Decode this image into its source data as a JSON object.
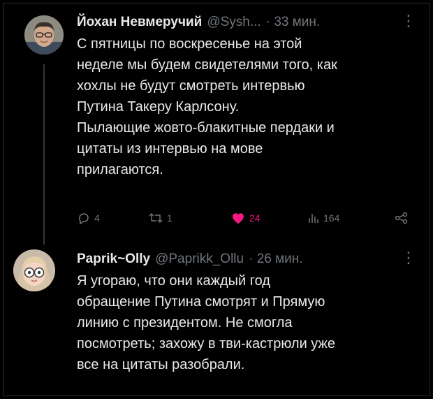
{
  "colors": {
    "background": "#000000",
    "text": "#e7e9ea",
    "muted": "#71767b",
    "like": "#f91880"
  },
  "tweets": [
    {
      "author": "Йохан Невмеручий",
      "handle": "@Sysh...",
      "time": "· 33 мин.",
      "more_icon": "more-dots-icon",
      "lines": [
        "С пятницы по воскресенье на этой",
        "неделе мы будем свидетелями того, как",
        "хохлы не будут смотреть интервью",
        "Путина  Такеру Карлсону.",
        "Пылающие  жовто-блакитные пердаки и",
        "цитаты из интервью на мове",
        "прилагаются."
      ],
      "actions": {
        "replies": "4",
        "retweets": "1",
        "likes": "24",
        "views": "164"
      }
    },
    {
      "author": "Paprik~Olly",
      "handle": "@Paprikk_Ollu",
      "time": "· 26 мин.",
      "more_icon": "more-dots-icon",
      "lines": [
        "Я угораю, что они каждый год",
        "обращение Путина смотрят и Прямую",
        "линию с президентом. Не смогла",
        "посмотреть; захожу в тви-кастрюли уже",
        "все на цитаты разобрали."
      ]
    }
  ]
}
